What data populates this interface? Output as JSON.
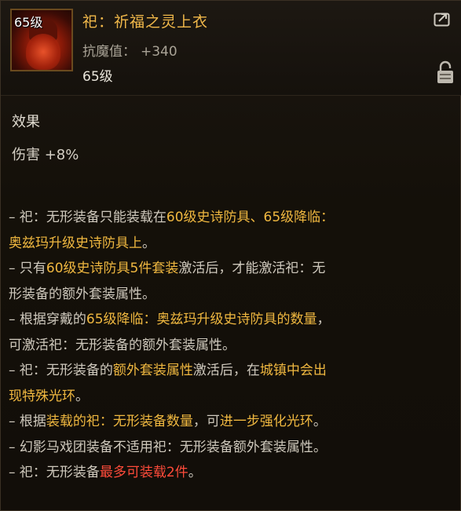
{
  "item": {
    "icon_level": "65级",
    "name": "祀：祈福之灵上衣",
    "stat_label": "抗魔值：",
    "stat_value": "+340",
    "level": "65级",
    "icons": {
      "share": "share-icon",
      "lock": "lock-icon"
    }
  },
  "effect": {
    "title": "效果",
    "text": "伤害 +8%"
  },
  "colors": {
    "highlight": "#f0b840",
    "warning": "#ff4b3a",
    "name": "#f1b84a"
  },
  "description": [
    [
      {
        "t": "– 祀：无形装备只能装载在",
        "c": "n"
      },
      {
        "t": "60级史诗防具、65级降临：",
        "c": "h"
      }
    ],
    [
      {
        "t": "奥兹玛升级史诗防具上",
        "c": "h"
      },
      {
        "t": "。",
        "c": "n"
      }
    ],
    [
      {
        "t": "– 只有",
        "c": "n"
      },
      {
        "t": "60级史诗防具5件套装",
        "c": "h"
      },
      {
        "t": "激活后，才能激活祀：无",
        "c": "n"
      }
    ],
    [
      {
        "t": "形装备的额外套装属性。",
        "c": "n"
      }
    ],
    [
      {
        "t": "– 根据穿戴的",
        "c": "n"
      },
      {
        "t": "65级降临：奥兹玛升级史诗防具的数量",
        "c": "h"
      },
      {
        "t": "，",
        "c": "n"
      }
    ],
    [
      {
        "t": "可激活祀：无形装备的额外套装属性。",
        "c": "n"
      }
    ],
    [
      {
        "t": "– 祀：无形装备的",
        "c": "n"
      },
      {
        "t": "额外套装属性",
        "c": "h"
      },
      {
        "t": "激活后，在",
        "c": "n"
      },
      {
        "t": "城镇中会出",
        "c": "h"
      }
    ],
    [
      {
        "t": "现特殊光环",
        "c": "h"
      },
      {
        "t": "。",
        "c": "n"
      }
    ],
    [
      {
        "t": "– 根据",
        "c": "n"
      },
      {
        "t": "装载的祀：无形装备数量",
        "c": "h"
      },
      {
        "t": "，可",
        "c": "n"
      },
      {
        "t": "进一步强化光环",
        "c": "h"
      },
      {
        "t": "。",
        "c": "n"
      }
    ],
    [
      {
        "t": "– 幻影马戏团装备不适用祀：无形装备额外套装属性。",
        "c": "n"
      }
    ],
    [
      {
        "t": "– 祀：无形装备",
        "c": "n"
      },
      {
        "t": "最多可装载2件",
        "c": "r"
      },
      {
        "t": "。",
        "c": "n"
      }
    ]
  ]
}
